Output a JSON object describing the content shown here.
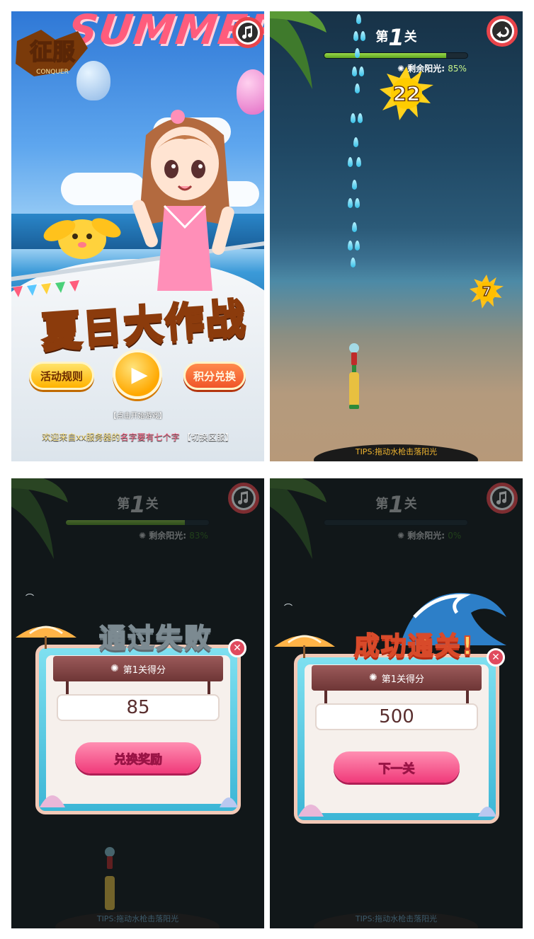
{
  "start_screen": {
    "banner_text": "SUMMER",
    "logo_text": "征服",
    "logo_sub": "CONQUER",
    "title": "夏日大作战",
    "rules_button": "活动规则",
    "exchange_button": "积分兑换",
    "play_hint": "【点击开始游戏】",
    "welcome_prefix": "欢迎来自xx服务器的",
    "welcome_name": "名字要有七个字",
    "switch_server": "【切换区服】"
  },
  "gameplay": {
    "level_prefix": "第",
    "level_number": "1",
    "level_suffix": "关",
    "progress_fraction": 0.85,
    "remaining_label": "剩余阳光:",
    "remaining_pct": "85%",
    "sun_big": "22",
    "sun_small": "7",
    "tips": "TIPS:拖动水枪击落阳光"
  },
  "fail_dialog": {
    "level_prefix": "第",
    "level_number": "1",
    "level_suffix": "关",
    "progress_fraction": 0.83,
    "remaining_label": "剩余阳光:",
    "remaining_pct": "83%",
    "title": "通过失败",
    "score_label": "第1关得分",
    "score": "85",
    "action_button": "兑换奖励",
    "close": "✕",
    "tips": "TIPS:拖动水枪击落阳光"
  },
  "win_dialog": {
    "level_prefix": "第",
    "level_number": "1",
    "level_suffix": "关",
    "progress_fraction": 0.0,
    "remaining_label": "剩余阳光:",
    "remaining_pct": "0%",
    "title": "成功通关!",
    "score_label": "第1关得分",
    "score": "500",
    "action_button": "下一关",
    "close": "✕",
    "tips": "TIPS:拖动水枪击落阳光"
  },
  "icons": {
    "music": "music-note-icon",
    "back": "back-arrow-icon",
    "gear": "sun-gear-icon"
  },
  "colors": {
    "accent_pink": "#f03a7a",
    "accent_yellow": "#ffb300",
    "progress_green": "#5ea420",
    "tips_orange": "#f0b530"
  }
}
